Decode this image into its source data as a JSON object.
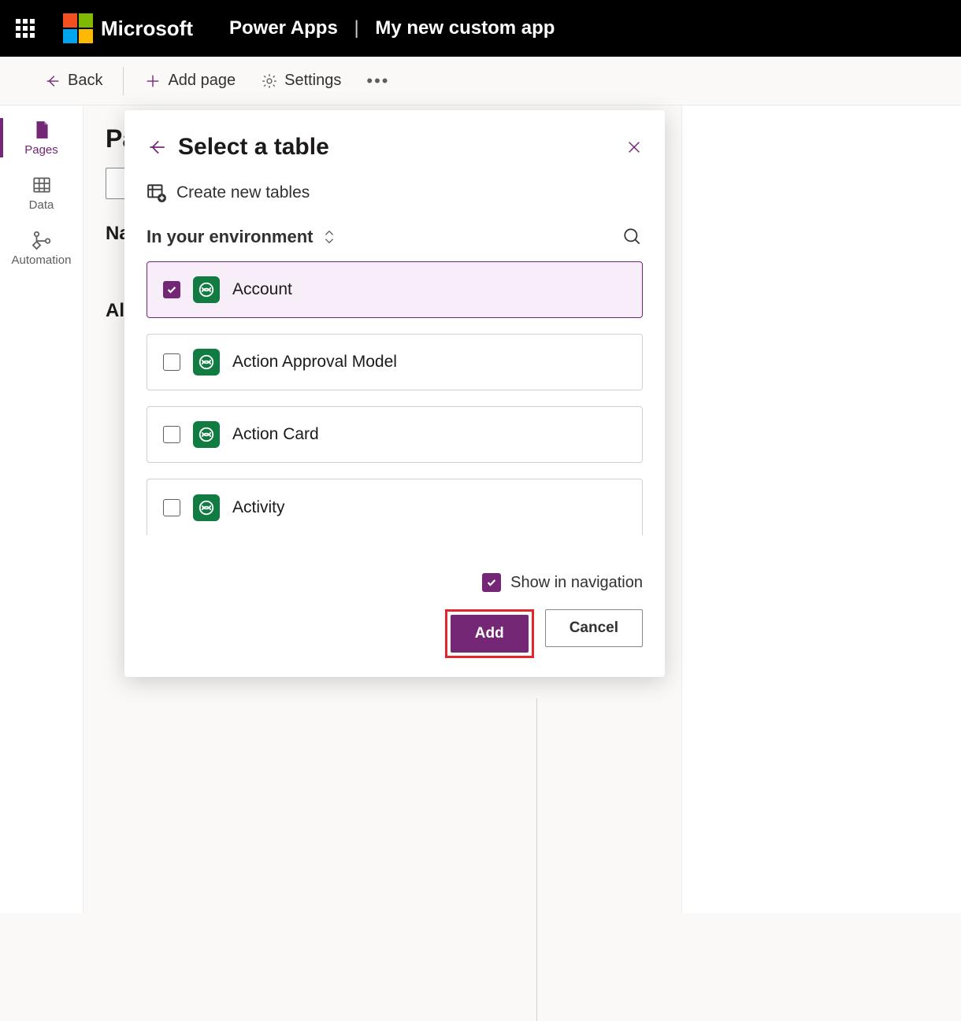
{
  "header": {
    "brand": "Microsoft",
    "app": "Power Apps",
    "app_name": "My new custom app"
  },
  "cmdbar": {
    "back": "Back",
    "add_page": "Add page",
    "settings": "Settings"
  },
  "rail": {
    "items": [
      {
        "id": "pages",
        "label": "Pages",
        "active": true
      },
      {
        "id": "data",
        "label": "Data",
        "active": false
      },
      {
        "id": "automation",
        "label": "Automation",
        "active": false
      }
    ]
  },
  "page": {
    "title_prefix": "Pa",
    "nav_heading": "Na",
    "all_heading": "Al"
  },
  "dialog": {
    "title": "Select a table",
    "create_new": "Create new tables",
    "env_label": "In your environment",
    "tables": [
      {
        "name": "Account",
        "selected": true
      },
      {
        "name": "Action Approval Model",
        "selected": false
      },
      {
        "name": "Action Card",
        "selected": false
      },
      {
        "name": "Activity",
        "selected": false
      }
    ],
    "show_in_nav": "Show in navigation",
    "show_in_nav_checked": true,
    "add_btn": "Add",
    "cancel_btn": "Cancel"
  }
}
